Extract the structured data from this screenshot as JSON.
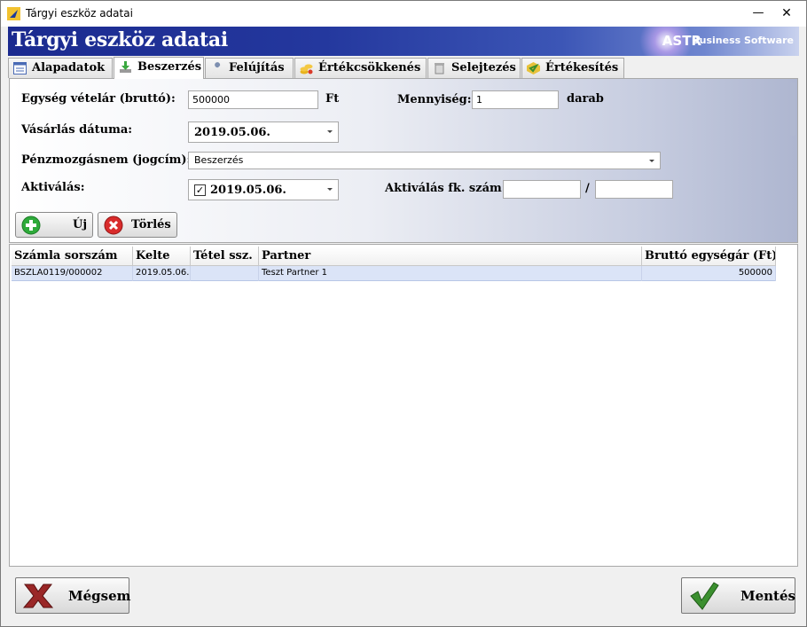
{
  "window": {
    "title": "Tárgyi eszköz adatai"
  },
  "banner": {
    "title": "Tárgyi eszköz adatai",
    "brand": "ASTR",
    "brand_sub": "Business Software"
  },
  "tabs": [
    {
      "label": "Alapadatok",
      "icon": "list-icon"
    },
    {
      "label": "Beszerzés",
      "icon": "download-icon"
    },
    {
      "label": "Felújítás",
      "icon": "wrench-icon"
    },
    {
      "label": "Értékcsökkenés",
      "icon": "coins-icon"
    },
    {
      "label": "Selejtezés",
      "icon": "trash-icon"
    },
    {
      "label": "Értékesítés",
      "icon": "sell-icon"
    }
  ],
  "active_tab": "Beszerzés",
  "form": {
    "unit_price_label": "Egység vételár (bruttó):",
    "unit_price_value": "500000",
    "unit_price_unit": "Ft",
    "quantity_label": "Mennyiség:",
    "quantity_value": "1",
    "quantity_unit": "darab",
    "purchase_date_label": "Vásárlás dátuma:",
    "purchase_date_value": "2019.05.06.",
    "payment_type_label": "Pénzmozgásnem (jogcím):",
    "payment_type_value": "Beszerzés",
    "activation_label": "Aktiválás:",
    "activation_checked": true,
    "activation_date_value": "2019.05.06.",
    "activation_ledger_label": "Aktiválás fk. szám:",
    "activation_ledger_value_1": "",
    "activation_ledger_separator": "/",
    "activation_ledger_value_2": ""
  },
  "buttons": {
    "new_label": "Új",
    "delete_label": "Törlés",
    "cancel_label": "Mégsem",
    "save_label": "Mentés"
  },
  "table": {
    "columns": [
      "Számla sorszám",
      "Kelte",
      "Tétel ssz.",
      "Partner",
      "Bruttó egységár (Ft)"
    ],
    "rows": [
      [
        "BSZLA0119/000002",
        "2019.05.06.",
        "",
        "Teszt Partner 1",
        "500000"
      ]
    ]
  },
  "colors": {
    "banner_dark": "#1b2a8f",
    "row_selected": "#dbe4f7",
    "new_green": "#2eaa3a",
    "delete_red": "#d92b2b"
  }
}
